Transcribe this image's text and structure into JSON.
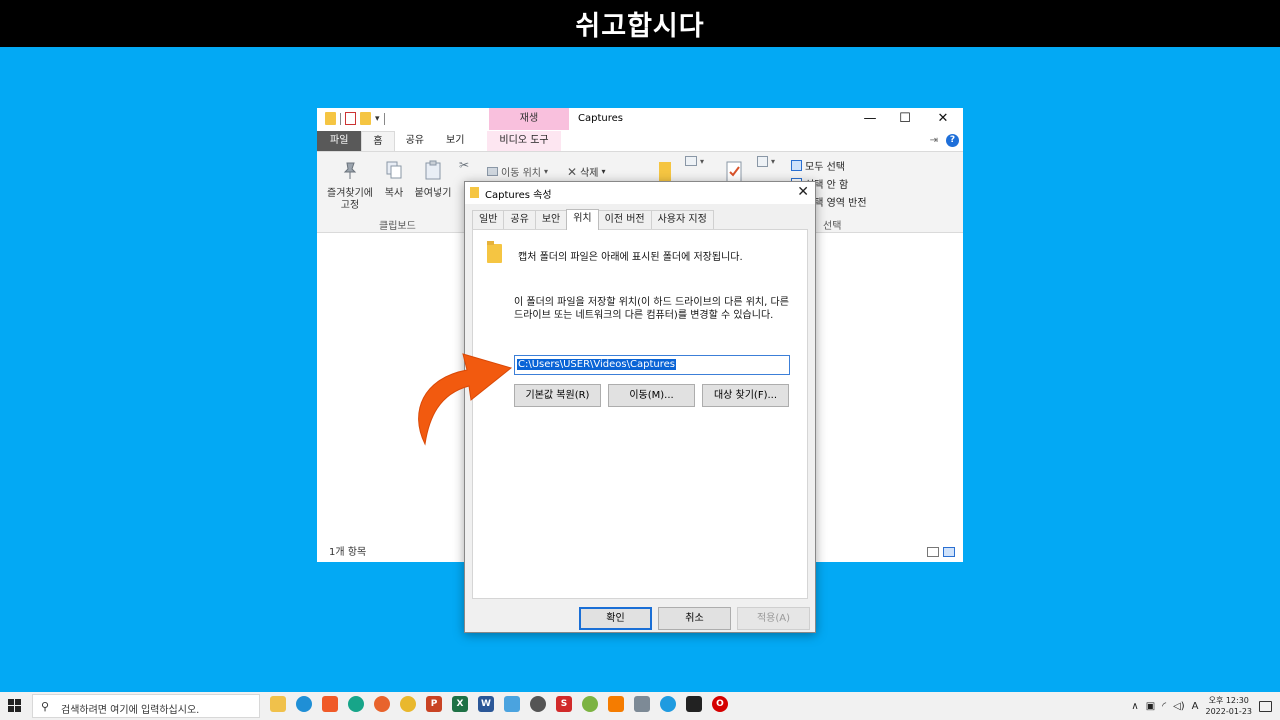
{
  "banner": {
    "title": "쉬고합시다"
  },
  "explorer": {
    "window_title": "Captures",
    "context_tab_group": "재생",
    "ribbon_tabs": [
      "파일",
      "홈",
      "공유",
      "보기",
      "비디오 도구"
    ],
    "ribbon": {
      "pin_label_line1": "즐겨찾기에",
      "pin_label_line2": "고정",
      "copy_label": "복사",
      "paste_label": "붙여넣기",
      "clipboard_group": "클립보드",
      "move_to_label": "이동 위치",
      "delete_label": "삭제",
      "select_all_label": "모두 선택",
      "select_none_label": "선택 안 함",
      "invert_selection_label": "선택 영역 반전",
      "select_group": "선택"
    },
    "status_text": "1개 항목"
  },
  "dialog": {
    "title": "Captures 속성",
    "tabs": [
      "일반",
      "공유",
      "보안",
      "위치",
      "이전 버전",
      "사용자 지정"
    ],
    "active_tab": "위치",
    "description_1": "캡처 폴더의 파일은 아래에 표시된 폴더에 저장됩니다.",
    "description_2": "이 폴더의 파일을 저장할 위치(이 하드 드라이브의 다른 위치, 다른 드라이브 또는 네트워크의 다른 컴퓨터)를 변경할 수 있습니다.",
    "path_value": "C:\\Users\\USER\\Videos\\Captures",
    "restore_default_label": "기본값 복원(R)",
    "move_label": "이동(M)...",
    "find_target_label": "대상 찾기(F)...",
    "ok_label": "확인",
    "cancel_label": "취소",
    "apply_label": "적용(A)"
  },
  "taskbar": {
    "search_placeholder": "검색하려면 여기에 입력하십시오.",
    "clock_time": "오후 12:30",
    "clock_date": "2022-01-23",
    "ime_indicator": "A"
  },
  "colors": {
    "desktop": "#03a9f4",
    "arrow": "#f25a0f",
    "accent": "#1a6fd6"
  }
}
